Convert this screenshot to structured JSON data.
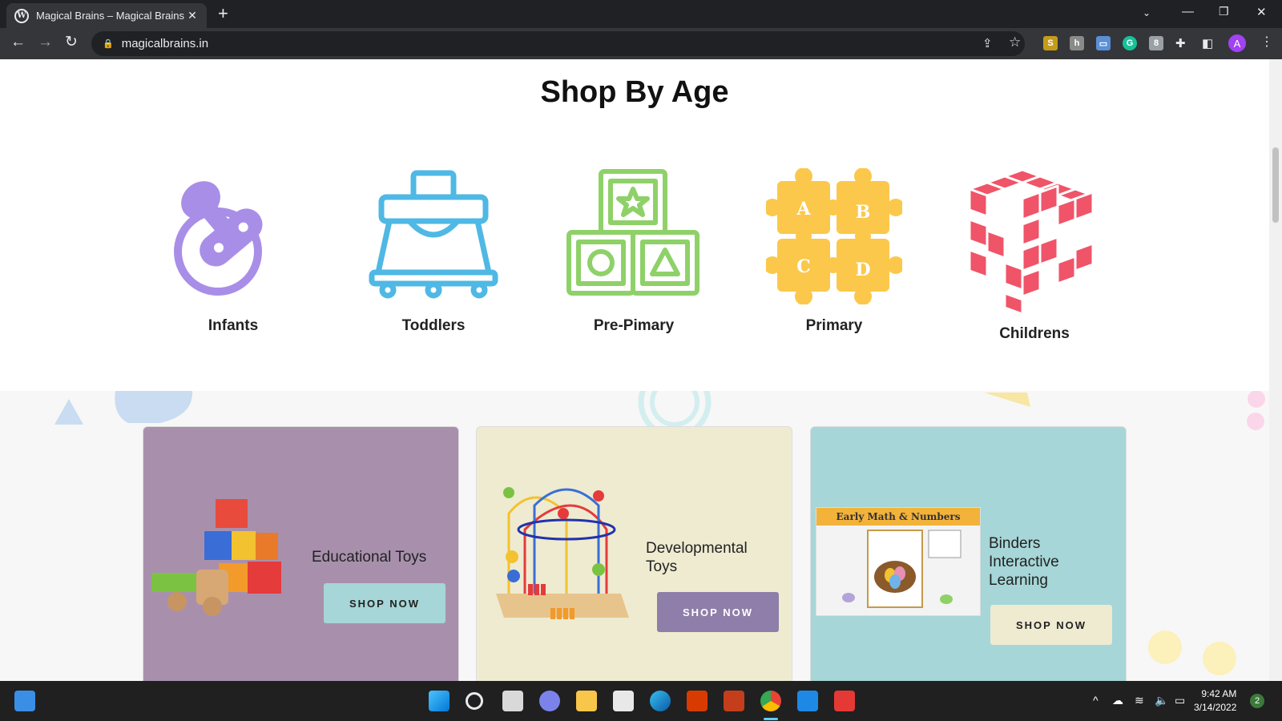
{
  "browser": {
    "tab_title": "Magical Brains – Magical Brains",
    "tab_close": "✕",
    "new_tab": "+",
    "url": "magicalbrains.in"
  },
  "profile_initial": "A",
  "page": {
    "heading": "Shop By Age",
    "ages": [
      {
        "label": "Infants"
      },
      {
        "label": "Toddlers"
      },
      {
        "label": "Pre-Pimary"
      },
      {
        "label": "Primary"
      },
      {
        "label": "Childrens"
      }
    ],
    "categories": [
      {
        "title": "Educational Toys",
        "button": "SHOP NOW"
      },
      {
        "title_line1": "Developmental",
        "title_line2": "Toys",
        "button": "SHOP NOW"
      },
      {
        "title_line1": "Binders",
        "title_line2": "Interactive",
        "title_line3": "Learning",
        "button": "SHOP NOW",
        "image_caption": "Early Math & Numbers"
      }
    ]
  },
  "taskbar": {
    "time": "9:42 AM",
    "date": "3/14/2022",
    "notification_count": "2"
  },
  "colors": {
    "infants": "#a98ee8",
    "toddlers": "#4fb8e4",
    "preprimary": "#8fd169",
    "primary": "#fbc84b",
    "childrens": "#ef5468",
    "card1_bg": "#a890ad",
    "card2_bg": "#eeebd1",
    "card3_bg": "#a6d6d7"
  }
}
